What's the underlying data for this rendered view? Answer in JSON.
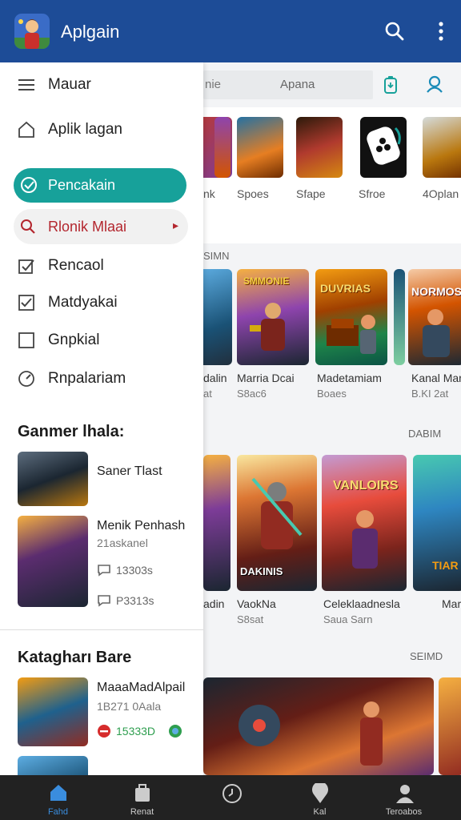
{
  "app": {
    "title": "Aplgain"
  },
  "search": {
    "text_left": "nie",
    "text_right": "Apana"
  },
  "drawer": {
    "menu": [
      {
        "label": "Mauar",
        "icon": "menu-icon"
      },
      {
        "label": "Aplik lagan",
        "icon": "home-icon"
      },
      {
        "label": "Pencakain",
        "icon": "check-circle-icon"
      },
      {
        "label": "Rlonik Mlaai",
        "icon": "search-icon"
      },
      {
        "label": "Rencaol",
        "icon": "checkbox-icon"
      },
      {
        "label": "Matdyakai",
        "icon": "checkbox-checked-icon"
      },
      {
        "label": "Gnpkial",
        "icon": "checkbox-empty-icon"
      },
      {
        "label": "Rnpalariam",
        "icon": "gauge-icon"
      }
    ],
    "section1_title": "Ganmer lhala:",
    "section1_games": [
      {
        "title": "Saner Tlast"
      },
      {
        "title": "Menik Penhash",
        "sub": "21askanel",
        "stat1": "13303s",
        "stat2": "P3313s"
      }
    ],
    "section2_title": "Katagharı Bare",
    "section2_games": [
      {
        "title": "MaaaMadAlpail",
        "sub": "1B271 0Aala",
        "stat": "15333D"
      }
    ]
  },
  "content": {
    "row1": [
      {
        "label": "nk"
      },
      {
        "label": "Spoes"
      },
      {
        "label": "Sfape"
      },
      {
        "label": "Sfroe"
      },
      {
        "label": "4Oplan"
      }
    ],
    "section_tag1": "SIMN",
    "row2": [
      {
        "title": "dalin",
        "sub": "at"
      },
      {
        "title": "Marria Dcai",
        "sub": "S8ac6"
      },
      {
        "title": "Madetamiam",
        "sub": "Boaes"
      },
      {
        "title": "Kanal Mar",
        "sub": "B.KI 2at"
      }
    ],
    "row2_card_titles": [
      "ЅMMONIE",
      "DUVRIAS",
      "NORMOS"
    ],
    "section_tag2": "DABIM",
    "row3": [
      {
        "title": "adin",
        "sub": ""
      },
      {
        "title": "VaokNa",
        "sub": "S8sat"
      },
      {
        "title": "Celeklaadnesla",
        "sub": "Saua Sarn"
      },
      {
        "title": "Mar",
        "sub": ""
      }
    ],
    "row3_card_titles": [
      "DAKINIS",
      "VANLOIRS",
      "TIAR"
    ],
    "section_tag3": "SEIMD"
  },
  "bottom_nav": [
    {
      "label": "Fahd",
      "icon": "home-icon"
    },
    {
      "label": "Renat",
      "icon": "bag-icon"
    },
    {
      "label": "",
      "icon": "clock-icon"
    },
    {
      "label": "Kal",
      "icon": "pin-icon"
    },
    {
      "label": "Teroabos",
      "icon": "person-icon"
    }
  ],
  "colors": {
    "appbar": "#1d4c97",
    "accent": "#17a19a",
    "selected": "#b3262e",
    "nav_active": "#3a8dde"
  }
}
